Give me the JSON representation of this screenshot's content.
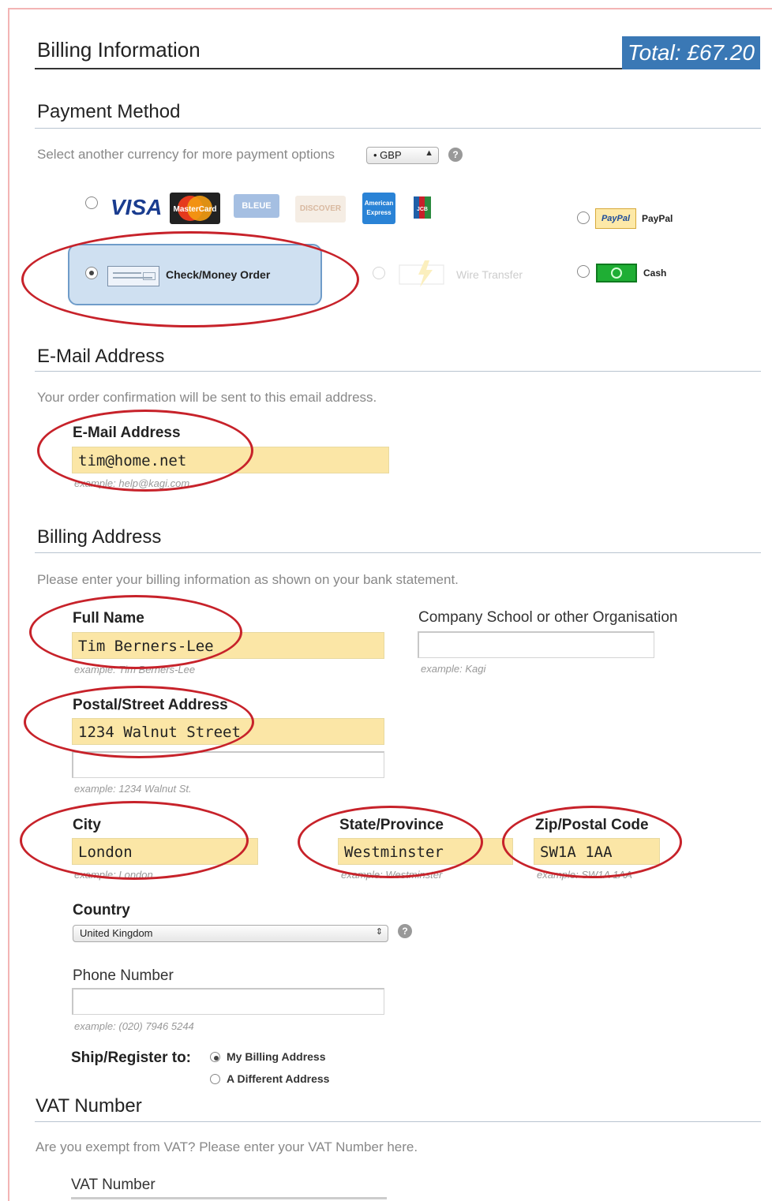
{
  "header": {
    "title": "Billing Information",
    "total": "Total: £67.20",
    "total_bg": "#3a78b5"
  },
  "payment": {
    "title": "Payment Method",
    "currency_hint": "Select another currency for more payment options",
    "currency_value": "• GBP",
    "cards": [
      "VISA",
      "MasterCard",
      "BLEUE",
      "DISCOVER",
      "American Express",
      "JCB"
    ],
    "check_label": "Check/Money Order",
    "wire_label": "Wire Transfer",
    "paypal_logo": "PayPal",
    "paypal_label": "PayPal",
    "cash_label": "Cash",
    "selected": "Check/Money Order"
  },
  "email": {
    "title": "E-Mail Address",
    "hint": "Your order confirmation will be sent to this email address.",
    "label": "E-Mail Address",
    "value": "tim@home.net",
    "example": "example: help@kagi.com"
  },
  "billing": {
    "title": "Billing Address",
    "hint": "Please enter your billing information as shown on your bank statement.",
    "full_name": {
      "label": "Full Name",
      "value": "Tim Berners-Lee",
      "example": "example: Tim Berners-Lee"
    },
    "company": {
      "label": "Company School or other Organisation",
      "value": "",
      "example": "example: Kagi"
    },
    "street": {
      "label": "Postal/Street Address",
      "value": "1234 Walnut Street",
      "example": "example: 1234 Walnut St."
    },
    "city": {
      "label": "City",
      "value": "London",
      "example": "example: London"
    },
    "state": {
      "label": "State/Province",
      "value": "Westminster",
      "example": "example: Westminster"
    },
    "zip": {
      "label": "Zip/Postal Code",
      "value": "SW1A 1AA",
      "example": "example: SW1A 1AA"
    },
    "country": {
      "label": "Country",
      "value": "United Kingdom"
    },
    "phone": {
      "label": "Phone Number",
      "value": "",
      "example": "example: (020) 7946 5244"
    },
    "ship": {
      "label": "Ship/Register to:",
      "option1": "My Billing Address",
      "option2": "A Different Address",
      "selected": "My Billing Address"
    }
  },
  "vat": {
    "title": "VAT Number",
    "hint": "Are you exempt from VAT? Please enter your VAT Number here.",
    "label": "VAT Number"
  },
  "colors": {
    "highlight_oval": "#c7222a",
    "field_fill": "#fbe6a6",
    "rule": "#b8c4d0"
  }
}
